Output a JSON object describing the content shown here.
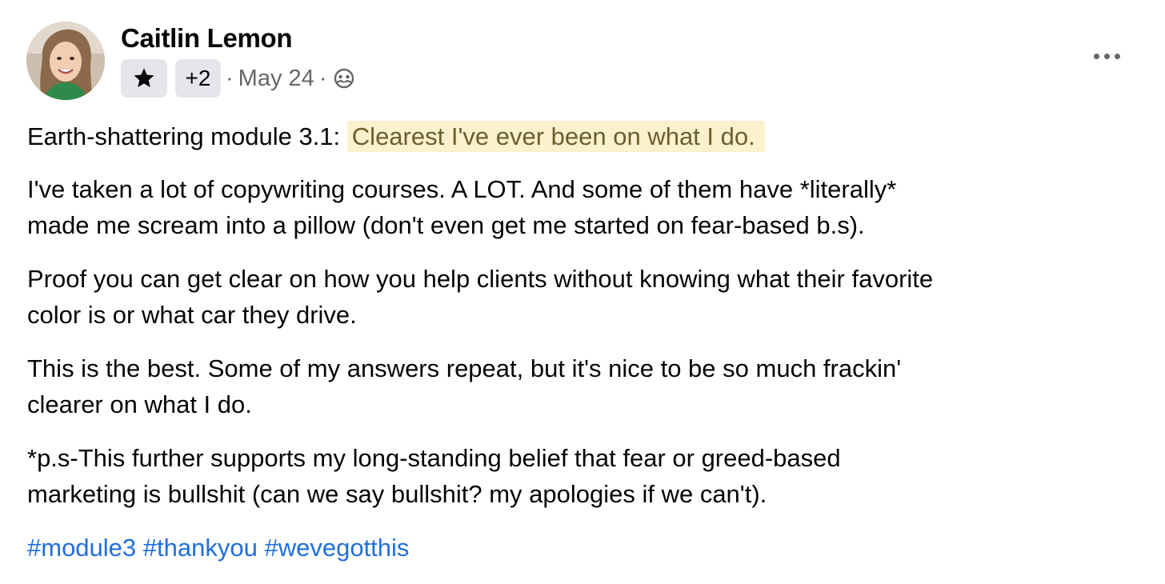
{
  "author": {
    "name": "Caitlin Lemon"
  },
  "meta": {
    "badge_icon": "star-icon",
    "badge_count": "+2",
    "separator": "·",
    "date": "May 24",
    "audience_icon": "group-icon"
  },
  "actions": {
    "more_icon": "more-dots-icon"
  },
  "post": {
    "intro": "Earth-shattering module 3.1:",
    "highlight": "Clearest I've ever been on what I do.",
    "paragraph_2_line_1": "I've taken a lot of copywriting courses. A LOT. And some of them have *literally*",
    "paragraph_2_line_2": "made me scream into a pillow (don't even get me started on fear-based b.s).",
    "paragraph_3_line_1": "Proof you can get clear on how you help clients without knowing what their favorite",
    "paragraph_3_line_2": "color is or what car they drive.",
    "paragraph_4_line_1": "This is the best. Some of my answers repeat, but it's nice to be so much frackin'",
    "paragraph_4_line_2": "clearer on what I do.",
    "paragraph_5_line_1": "*p.s-This further supports my long-standing belief that fear or greed-based",
    "paragraph_5_line_2": "marketing is bullshit (can we say bullshit? my apologies if we can't).",
    "hashtags": [
      "#module3",
      "#thankyou",
      "#wevegotthis"
    ]
  },
  "colors": {
    "text": "#050505",
    "secondary_text": "#65676b",
    "badge_bg": "#e4e6eb",
    "highlight_bg": "#fbf1cc",
    "hashtag": "#216fdb"
  }
}
